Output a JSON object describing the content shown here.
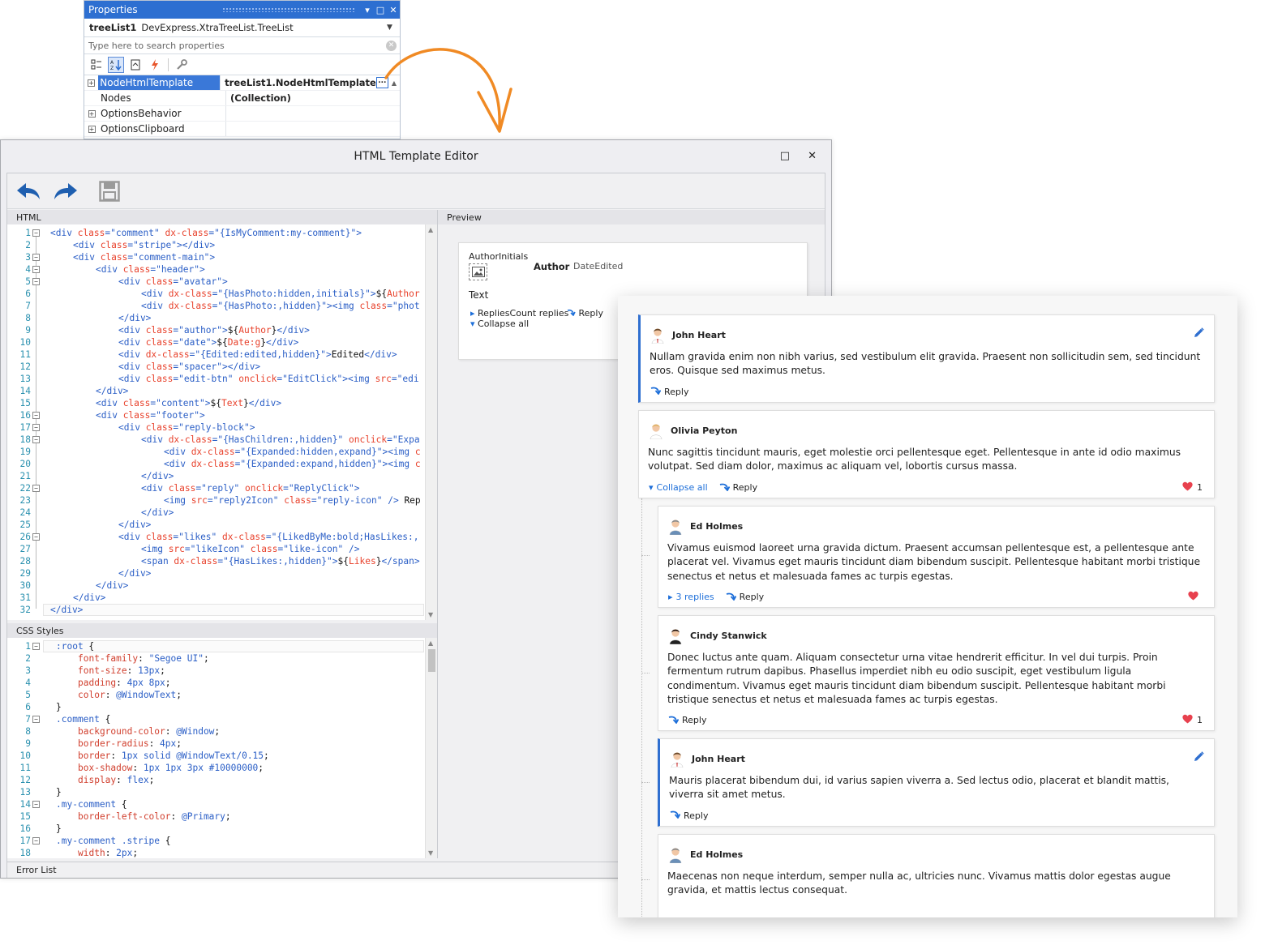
{
  "properties": {
    "title": "Properties",
    "object_name": "treeList1",
    "object_type": "DevExpress.XtraTreeList.TreeList",
    "search_placeholder": "Type here to search properties",
    "rows": [
      {
        "name": "NodeHtmlTemplate",
        "value": "treeList1.NodeHtmlTemplate",
        "expandable": true,
        "selected": true
      },
      {
        "name": "Nodes",
        "value": "(Collection)",
        "expandable": false,
        "selected": false
      },
      {
        "name": "OptionsBehavior",
        "value": "",
        "expandable": true,
        "selected": false
      },
      {
        "name": "OptionsClipboard",
        "value": "",
        "expandable": true,
        "selected": false
      }
    ],
    "ellipsis": "..."
  },
  "editor": {
    "title": "HTML Template Editor",
    "html_label": "HTML",
    "css_label": "CSS Styles",
    "preview_label": "Preview",
    "error_list_label": "Error List"
  },
  "html_code": [
    [
      [
        "tg",
        "<div "
      ],
      [
        "at",
        "class"
      ],
      [
        "tg",
        "="
      ],
      [
        "vl",
        "\"comment\""
      ],
      [
        "at",
        " dx-class"
      ],
      [
        "tg",
        "="
      ],
      [
        "vl",
        "\"{IsMyComment:my-comment}\""
      ],
      [
        "tg",
        ">"
      ]
    ],
    [
      [
        "tg",
        "<div "
      ],
      [
        "at",
        "class"
      ],
      [
        "tg",
        "="
      ],
      [
        "vl",
        "\"stripe\""
      ],
      [
        "tg",
        "></div>"
      ]
    ],
    [
      [
        "tg",
        "<div "
      ],
      [
        "at",
        "class"
      ],
      [
        "tg",
        "="
      ],
      [
        "vl",
        "\"comment-main\""
      ],
      [
        "tg",
        ">"
      ]
    ],
    [
      [
        "tg",
        "<div "
      ],
      [
        "at",
        "class"
      ],
      [
        "tg",
        "="
      ],
      [
        "vl",
        "\"header\""
      ],
      [
        "tg",
        ">"
      ]
    ],
    [
      [
        "tg",
        "<div "
      ],
      [
        "at",
        "class"
      ],
      [
        "tg",
        "="
      ],
      [
        "vl",
        "\"avatar\""
      ],
      [
        "tg",
        ">"
      ]
    ],
    [
      [
        "tg",
        "<div "
      ],
      [
        "at",
        "dx-class"
      ],
      [
        "tg",
        "="
      ],
      [
        "vl",
        "\"{HasPhoto:hidden,initials}\""
      ],
      [
        "tg",
        ">"
      ],
      [
        "tx",
        "${"
      ],
      [
        "at",
        "Author"
      ]
    ],
    [
      [
        "tg",
        "<div "
      ],
      [
        "at",
        "dx-class"
      ],
      [
        "tg",
        "="
      ],
      [
        "vl",
        "\"{HasPhoto:,hidden}\""
      ],
      [
        "tg",
        "><img "
      ],
      [
        "at",
        "class"
      ],
      [
        "tg",
        "="
      ],
      [
        "vl",
        "\"phot"
      ]
    ],
    [
      [
        "tg",
        "</div>"
      ]
    ],
    [
      [
        "tg",
        "<div "
      ],
      [
        "at",
        "class"
      ],
      [
        "tg",
        "="
      ],
      [
        "vl",
        "\"author\""
      ],
      [
        "tg",
        ">"
      ],
      [
        "tx",
        "${"
      ],
      [
        "at",
        "Author"
      ],
      [
        "tx",
        "}"
      ],
      [
        "tg",
        "</div>"
      ]
    ],
    [
      [
        "tg",
        "<div "
      ],
      [
        "at",
        "class"
      ],
      [
        "tg",
        "="
      ],
      [
        "vl",
        "\"date\""
      ],
      [
        "tg",
        ">"
      ],
      [
        "tx",
        "${"
      ],
      [
        "at",
        "Date:g"
      ],
      [
        "tx",
        "}"
      ],
      [
        "tg",
        "</div>"
      ]
    ],
    [
      [
        "tg",
        "<div "
      ],
      [
        "at",
        "dx-class"
      ],
      [
        "tg",
        "="
      ],
      [
        "vl",
        "\"{Edited:edited,hidden}\""
      ],
      [
        "tg",
        ">"
      ],
      [
        "tx",
        "Edited"
      ],
      [
        "tg",
        "</div>"
      ]
    ],
    [
      [
        "tg",
        "<div "
      ],
      [
        "at",
        "class"
      ],
      [
        "tg",
        "="
      ],
      [
        "vl",
        "\"spacer\""
      ],
      [
        "tg",
        "></div>"
      ]
    ],
    [
      [
        "tg",
        "<div "
      ],
      [
        "at",
        "class"
      ],
      [
        "tg",
        "="
      ],
      [
        "vl",
        "\"edit-btn\""
      ],
      [
        "at",
        " onclick"
      ],
      [
        "tg",
        "="
      ],
      [
        "vl",
        "\"EditClick\""
      ],
      [
        "tg",
        "><img "
      ],
      [
        "at",
        "src"
      ],
      [
        "tg",
        "="
      ],
      [
        "vl",
        "\"edi"
      ]
    ],
    [
      [
        "tg",
        "</div>"
      ]
    ],
    [
      [
        "tg",
        "<div "
      ],
      [
        "at",
        "class"
      ],
      [
        "tg",
        "="
      ],
      [
        "vl",
        "\"content\""
      ],
      [
        "tg",
        ">"
      ],
      [
        "tx",
        "${"
      ],
      [
        "at",
        "Text"
      ],
      [
        "tx",
        "}"
      ],
      [
        "tg",
        "</div>"
      ]
    ],
    [
      [
        "tg",
        "<div "
      ],
      [
        "at",
        "class"
      ],
      [
        "tg",
        "="
      ],
      [
        "vl",
        "\"footer\""
      ],
      [
        "tg",
        ">"
      ]
    ],
    [
      [
        "tg",
        "<div "
      ],
      [
        "at",
        "class"
      ],
      [
        "tg",
        "="
      ],
      [
        "vl",
        "\"reply-block\""
      ],
      [
        "tg",
        ">"
      ]
    ],
    [
      [
        "tg",
        "<div "
      ],
      [
        "at",
        "dx-class"
      ],
      [
        "tg",
        "="
      ],
      [
        "vl",
        "\"{HasChildren:,hidden}\""
      ],
      [
        "at",
        " onclick"
      ],
      [
        "tg",
        "="
      ],
      [
        "vl",
        "\"Expa"
      ]
    ],
    [
      [
        "tg",
        "<div "
      ],
      [
        "at",
        "dx-class"
      ],
      [
        "tg",
        "="
      ],
      [
        "vl",
        "\"{Expanded:hidden,expand}\""
      ],
      [
        "tg",
        "><img "
      ],
      [
        "at",
        "c"
      ]
    ],
    [
      [
        "tg",
        "<div "
      ],
      [
        "at",
        "dx-class"
      ],
      [
        "tg",
        "="
      ],
      [
        "vl",
        "\"{Expanded:expand,hidden}\""
      ],
      [
        "tg",
        "><img "
      ],
      [
        "at",
        "c"
      ]
    ],
    [
      [
        "tg",
        "</div>"
      ]
    ],
    [
      [
        "tg",
        "<div "
      ],
      [
        "at",
        "class"
      ],
      [
        "tg",
        "="
      ],
      [
        "vl",
        "\"reply\""
      ],
      [
        "at",
        " onclick"
      ],
      [
        "tg",
        "="
      ],
      [
        "vl",
        "\"ReplyClick\""
      ],
      [
        "tg",
        ">"
      ]
    ],
    [
      [
        "tg",
        "<img "
      ],
      [
        "at",
        "src"
      ],
      [
        "tg",
        "="
      ],
      [
        "vl",
        "\"reply2Icon\""
      ],
      [
        "at",
        " class"
      ],
      [
        "tg",
        "="
      ],
      [
        "vl",
        "\"reply-icon\""
      ],
      [
        "tg",
        " /> "
      ],
      [
        "tx",
        "Rep"
      ]
    ],
    [
      [
        "tg",
        "</div>"
      ]
    ],
    [
      [
        "tg",
        "</div>"
      ]
    ],
    [
      [
        "tg",
        "<div "
      ],
      [
        "at",
        "class"
      ],
      [
        "tg",
        "="
      ],
      [
        "vl",
        "\"likes\""
      ],
      [
        "at",
        " dx-class"
      ],
      [
        "tg",
        "="
      ],
      [
        "vl",
        "\"{LikedByMe:bold;HasLikes:,"
      ]
    ],
    [
      [
        "tg",
        "<img "
      ],
      [
        "at",
        "src"
      ],
      [
        "tg",
        "="
      ],
      [
        "vl",
        "\"likeIcon\""
      ],
      [
        "at",
        " class"
      ],
      [
        "tg",
        "="
      ],
      [
        "vl",
        "\"like-icon\""
      ],
      [
        "tg",
        " />"
      ]
    ],
    [
      [
        "tg",
        "<span "
      ],
      [
        "at",
        "dx-class"
      ],
      [
        "tg",
        "="
      ],
      [
        "vl",
        "\"{HasLikes:,hidden}\""
      ],
      [
        "tg",
        ">"
      ],
      [
        "tx",
        "${"
      ],
      [
        "at",
        "Likes"
      ],
      [
        "tx",
        "}"
      ],
      [
        "tg",
        "</span>"
      ]
    ],
    [
      [
        "tg",
        "</div>"
      ]
    ],
    [
      [
        "tg",
        "</div>"
      ]
    ],
    [
      [
        "tg",
        "</div>"
      ]
    ],
    [
      [
        "tg",
        "</div>"
      ]
    ]
  ],
  "css_code": [
    [
      [
        "tg",
        ":root "
      ],
      [
        "tx",
        "{"
      ]
    ],
    [
      [
        "cp",
        "font-family"
      ],
      [
        "tx",
        ": "
      ],
      [
        "cv",
        "\"Segoe UI\""
      ],
      [
        "tx",
        ";"
      ]
    ],
    [
      [
        "cp",
        "font-size"
      ],
      [
        "tx",
        ": "
      ],
      [
        "cv",
        "13px"
      ],
      [
        "tx",
        ";"
      ]
    ],
    [
      [
        "cp",
        "padding"
      ],
      [
        "tx",
        ": "
      ],
      [
        "cv",
        "4px 8px"
      ],
      [
        "tx",
        ";"
      ]
    ],
    [
      [
        "cp",
        "color"
      ],
      [
        "tx",
        ": "
      ],
      [
        "cv",
        "@WindowText"
      ],
      [
        "tx",
        ";"
      ]
    ],
    [
      [
        "tx",
        "}"
      ]
    ],
    [
      [
        "tg",
        ".comment "
      ],
      [
        "tx",
        "{"
      ]
    ],
    [
      [
        "cp",
        "background-color"
      ],
      [
        "tx",
        ": "
      ],
      [
        "cv",
        "@Window"
      ],
      [
        "tx",
        ";"
      ]
    ],
    [
      [
        "cp",
        "border-radius"
      ],
      [
        "tx",
        ": "
      ],
      [
        "cv",
        "4px"
      ],
      [
        "tx",
        ";"
      ]
    ],
    [
      [
        "cp",
        "border"
      ],
      [
        "tx",
        ": "
      ],
      [
        "cv",
        "1px solid @WindowText/0.15"
      ],
      [
        "tx",
        ";"
      ]
    ],
    [
      [
        "cp",
        "box-shadow"
      ],
      [
        "tx",
        ": "
      ],
      [
        "cv",
        "1px 1px 3px #10000000"
      ],
      [
        "tx",
        ";"
      ]
    ],
    [
      [
        "cp",
        "display"
      ],
      [
        "tx",
        ": "
      ],
      [
        "cv",
        "flex"
      ],
      [
        "tx",
        ";"
      ]
    ],
    [
      [
        "tx",
        "}"
      ]
    ],
    [
      [
        "tg",
        ".my-comment "
      ],
      [
        "tx",
        "{"
      ]
    ],
    [
      [
        "cp",
        "border-left-color"
      ],
      [
        "tx",
        ": "
      ],
      [
        "cv",
        "@Primary"
      ],
      [
        "tx",
        ";"
      ]
    ],
    [
      [
        "tx",
        "}"
      ]
    ],
    [
      [
        "tg",
        ".my-comment .stripe "
      ],
      [
        "tx",
        "{"
      ]
    ],
    [
      [
        "cp",
        "width"
      ],
      [
        "tx",
        ": "
      ],
      [
        "cv",
        "2px"
      ],
      [
        "tx",
        ";"
      ]
    ]
  ],
  "preview": {
    "initials": "AuthorInitials",
    "author": "Author",
    "date": "DateEdited",
    "text": "Text",
    "replies": "RepliesCount replies",
    "reply": "Reply",
    "collapse": "Collapse all"
  },
  "comments": [
    {
      "author": "John Heart",
      "text": "Nullam gravida enim non nibh varius, sed vestibulum elit gravida. Praesent non sollicitudin sem, sed tincidunt eros. Quisque sed maximus metus.",
      "reply": "Reply",
      "expander": "",
      "likes": "",
      "liked": false,
      "mine": true
    },
    {
      "author": "Olivia Peyton",
      "text": "Nunc sagittis tincidunt mauris, eget molestie orci pellentesque eget. Pellentesque in ante id odio maximus volutpat. Sed diam dolor, maximus ac aliquam vel, lobortis cursus massa.",
      "reply": "Reply",
      "expander": "Collapse all",
      "likes": "1",
      "liked": true,
      "mine": false
    },
    {
      "author": "Ed Holmes",
      "text": "Vivamus euismod laoreet urna gravida dictum. Praesent accumsan pellentesque est, a pellentesque ante placerat vel. Vivamus eget mauris tincidunt diam bibendum suscipit. Pellentesque habitant morbi tristique senectus et netus et malesuada fames ac turpis egestas.",
      "reply": "Reply",
      "expander": "3 replies",
      "likes": "",
      "liked": true,
      "mine": false
    },
    {
      "author": "Cindy Stanwick",
      "text": "Donec luctus ante quam. Aliquam consectetur urna vitae hendrerit efficitur. In vel dui turpis. Proin fermentum rutrum dapibus. Phasellus imperdiet nibh eu odio suscipit, eget vestibulum ligula condimentum. Vivamus eget mauris tincidunt diam bibendum suscipit. Pellentesque habitant morbi tristique senectus et netus et malesuada fames ac turpis egestas.",
      "reply": "Reply",
      "expander": "",
      "likes": "1",
      "liked": true,
      "mine": false
    },
    {
      "author": "John Heart",
      "text": "Mauris placerat bibendum dui, id varius sapien viverra a. Sed lectus odio, placerat et blandit mattis, viverra sit amet metus.",
      "reply": "Reply",
      "expander": "",
      "likes": "",
      "liked": false,
      "mine": true
    },
    {
      "author": "Ed Holmes",
      "text": "Maecenas non neque interdum, semper nulla ac, ultricies nunc. Vivamus mattis dolor egestas augue gravida, et mattis lectus consequat.",
      "reply": "",
      "expander": "",
      "likes": "",
      "liked": false,
      "mine": false
    }
  ],
  "colors": {
    "accent": "#2f6fd0",
    "link": "#1e6fd9",
    "like": "#e8414e",
    "arrow": "#f08a24",
    "titlebar": "#2d6fd1"
  }
}
